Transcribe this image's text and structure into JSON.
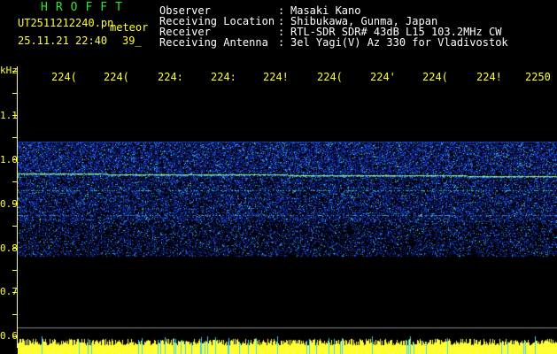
{
  "header": {
    "logo": "HROFFT",
    "filename": "UT2511212240.pn",
    "mode": "meteor",
    "date": "25.11.21 22:40",
    "count": "39_",
    "labels": [
      "Observer",
      "Receiving Location",
      "Receiver",
      "Receiving Antenna"
    ],
    "colons": [
      ":",
      ":",
      ":",
      ":"
    ],
    "values": [
      "Masaki Kano",
      "Shibukawa, Gunma, Japan",
      "RTL-SDR SDR# 43dB L15 103.2MHz CW",
      "3el Yagi(V) Az 330 for Vladivostok"
    ]
  },
  "axis": {
    "unit": "kHz",
    "y_ticks": [
      "1.1",
      "1.0",
      "0.9",
      "0.8",
      "0.7",
      "0.6"
    ],
    "x_ticks": [
      "224(",
      "224(",
      "224:",
      "224:",
      "224!",
      "224(",
      "224'",
      "224(",
      "224!",
      "2250"
    ]
  },
  "colors": {
    "text": "#ffffff",
    "accent": "#ffff33",
    "logo": "#2ee62e",
    "background": "#000000"
  }
}
